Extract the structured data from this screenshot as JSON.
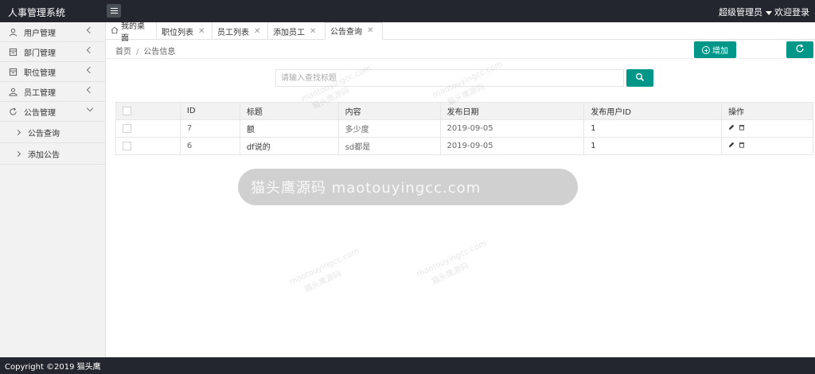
{
  "header": {
    "brand": "人事管理系统",
    "user_name": "超级管理员",
    "welcome": "欢迎登录"
  },
  "sidebar": {
    "items": [
      {
        "label": "用户管理",
        "icon": "user-icon"
      },
      {
        "label": "部门管理",
        "icon": "doc-icon"
      },
      {
        "label": "职位管理",
        "icon": "doc-icon"
      },
      {
        "label": "员工管理",
        "icon": "group-icon"
      },
      {
        "label": "公告管理",
        "icon": "refresh-icon",
        "expanded": true
      }
    ],
    "sub_items": [
      {
        "label": "公告查询"
      },
      {
        "label": "添加公告"
      }
    ]
  },
  "tabs": [
    {
      "label": "我的桌面",
      "closable": false
    },
    {
      "label": "职位列表",
      "closable": true
    },
    {
      "label": "员工列表",
      "closable": true
    },
    {
      "label": "添加员工",
      "closable": true
    },
    {
      "label": "公告查询",
      "closable": true,
      "active": true
    }
  ],
  "breadcrumb": {
    "home": "首页",
    "separator": "/",
    "current": "公告信息"
  },
  "toolbar": {
    "add_label": "增加"
  },
  "search": {
    "placeholder": "请输入查找标题",
    "value": ""
  },
  "table": {
    "headers": [
      "ID",
      "标题",
      "内容",
      "发布日期",
      "发布用户ID",
      "操作"
    ],
    "rows": [
      {
        "id": "7",
        "title": "额",
        "content": "多少度",
        "date": "2019-09-05",
        "user_id": "1"
      },
      {
        "id": "6",
        "title": "df说的",
        "content": "sd都是",
        "date": "2019-09-05",
        "user_id": "1"
      }
    ]
  },
  "overlay": {
    "text": "猫头鹰源码 maotouyingcc.com"
  },
  "watermark": {
    "url": "maotouyingcc.com",
    "name": "猫头鹰源码"
  },
  "footer": {
    "copyright": "Copyright ©2019 猫头鹰"
  },
  "colors": {
    "accent": "#009688",
    "header_bg": "#23262e",
    "sidebar_bg": "#f2f2f2"
  }
}
